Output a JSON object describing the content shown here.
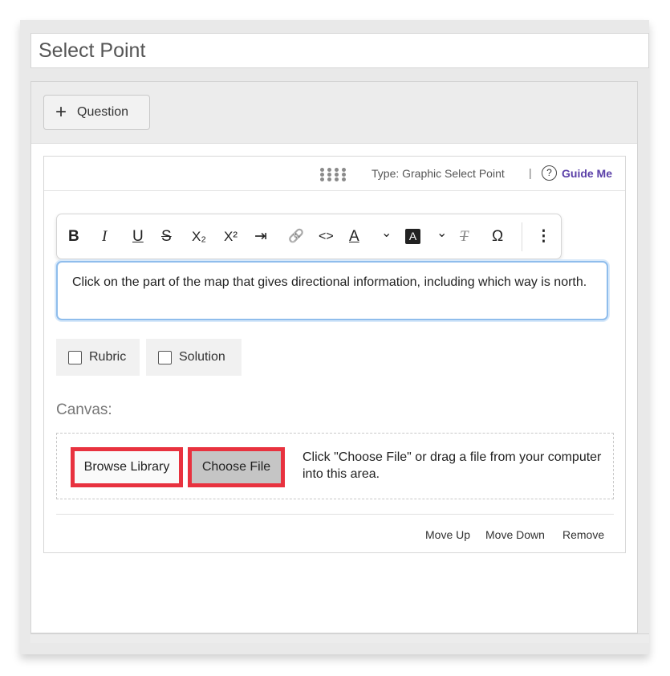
{
  "title_field": {
    "value": "Select Point"
  },
  "header": {
    "add_question": {
      "icon": "plus-icon",
      "label": "Question"
    }
  },
  "question_card": {
    "type_label": "Type: Graphic Select Point",
    "separator": "|",
    "help_icon": "?",
    "guide_me": "Guide Me",
    "toolbar": [
      {
        "name": "bold",
        "glyph": "B"
      },
      {
        "name": "italic",
        "glyph": "I"
      },
      {
        "name": "underline",
        "glyph": "U"
      },
      {
        "name": "strikethrough",
        "glyph": "S"
      },
      {
        "name": "subscript",
        "glyph": "X₂"
      },
      {
        "name": "superscript",
        "glyph": "X²"
      },
      {
        "name": "indent",
        "glyph": "⇥"
      },
      {
        "name": "link",
        "glyph": "🔗"
      },
      {
        "name": "code",
        "glyph": "<>"
      },
      {
        "name": "text-color",
        "glyph": "A"
      },
      {
        "name": "text-color-dropdown",
        "glyph": "⌄"
      },
      {
        "name": "background-color",
        "glyph": "A"
      },
      {
        "name": "background-color-dropdown",
        "glyph": "⌄"
      },
      {
        "name": "clear-format",
        "glyph": "T"
      },
      {
        "name": "special-char",
        "glyph": "Ω"
      },
      {
        "name": "more",
        "glyph": "⋮"
      }
    ],
    "prompt_text": "Click on the part of the map that gives directional information, including which way is north.",
    "rubric_label": "Rubric",
    "solution_label": "Solution",
    "canvas_label": "Canvas:",
    "browse_library": "Browse Library",
    "choose_file": "Choose File",
    "drop_hint": "Click \"Choose File\" or drag a file from your computer into this area.",
    "footer": {
      "move_up": "Move Up",
      "move_down": "Move Down",
      "remove": "Remove"
    }
  },
  "colors": {
    "accent_purple": "#5b40a8",
    "highlight_red": "#e8323f",
    "focus_blue": "#8fbdec"
  }
}
